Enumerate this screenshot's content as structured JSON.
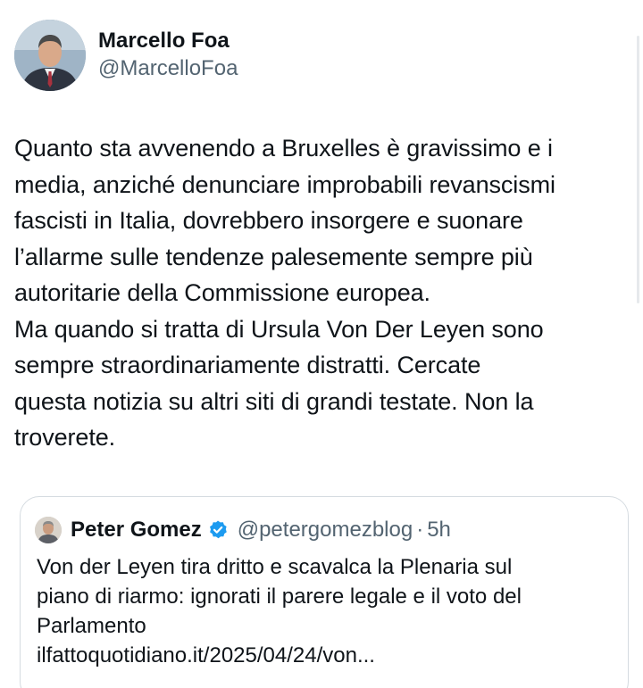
{
  "author": {
    "display_name": "Marcello Foa",
    "handle": "@MarcelloFoa",
    "avatar_icon": "user-avatar-photo"
  },
  "post": {
    "lines": [
      "Quanto sta avvenendo a Bruxelles è gravissimo e i",
      "media, anziché denunciare improbabili revanscismi",
      "fascisti in Italia, dovrebbero insorgere e suonare",
      "l’allarme sulle tendenze palesemente sempre più",
      "autoritarie della Commissione europea.",
      "Ma quando si tratta di Ursula Von Der Leyen sono",
      "sempre straordinariamente distratti. Cercate",
      "questa notizia su altri siti di grandi testate. Non la",
      "troverete."
    ]
  },
  "quoted": {
    "display_name": "Peter Gomez",
    "verified_icon": "verified-badge-icon",
    "handle": "@petergomezblog",
    "separator": "·",
    "time": "5h",
    "lines": [
      "Von der Leyen tira dritto e scavalca la Plenaria sul",
      "piano di riarmo: ignorati il parere legale e il voto del",
      "Parlamento"
    ],
    "link": "ilfattoquotidiano.it/2025/04/24/von..."
  },
  "colors": {
    "text": "#0f1419",
    "secondary": "#536471",
    "verified_blue": "#1d9bf0",
    "border": "#d5dbe0"
  }
}
